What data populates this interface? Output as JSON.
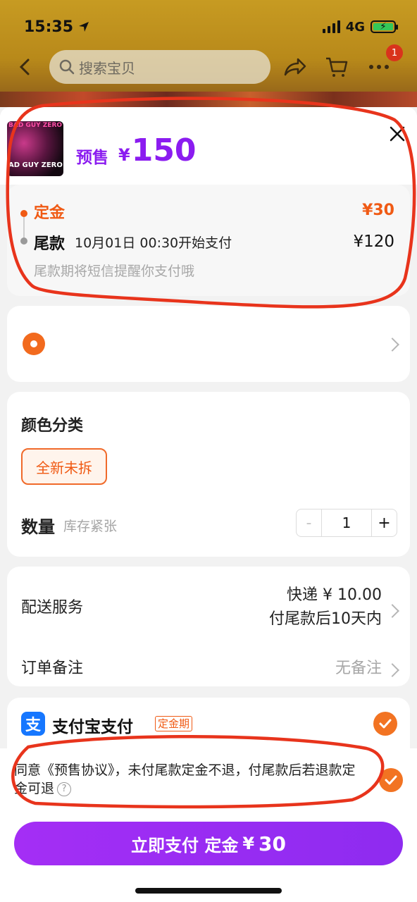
{
  "status_bar": {
    "time": "15:35",
    "network": "4G"
  },
  "nav": {
    "search_placeholder": "搜索宝贝",
    "cart_badge": "1"
  },
  "product": {
    "thumb_text_top": "BAD GUY ZERO",
    "thumb_text_bottom": "AD GUY ZERO",
    "presale_label": "预售",
    "currency": "¥",
    "price": "150"
  },
  "deposit": {
    "deposit_label": "定金",
    "deposit_amount": "¥30",
    "balance_label": "尾款",
    "balance_time": "10月01日 00:30开始支付",
    "balance_amount": "¥120",
    "balance_note": "尾款期将短信提醒你支付哦"
  },
  "options": {
    "color_title": "颜色分类",
    "selected_color": "全新未拆",
    "qty_label": "数量",
    "stock_note": "库存紧张",
    "qty_minus": "-",
    "qty_value": "1",
    "qty_plus": "+"
  },
  "delivery": {
    "label": "配送服务",
    "line1": "快递 ¥ 10.00",
    "line2": "付尾款后10天内",
    "note_label": "订单备注",
    "note_value": "无备注"
  },
  "payment": {
    "alipay_glyph": "支",
    "method": "支付宝支付",
    "tag": "定金期"
  },
  "agreement": {
    "text": "同意《预售协议》，未付尾款定金不退，付尾款后若退款定金可退",
    "help": "?"
  },
  "bottom": {
    "pay_label": "立即支付 定金",
    "pay_currency": "¥",
    "pay_amount": "30"
  },
  "colors": {
    "brand_purple": "#8b1cf0",
    "accent_orange": "#f05a14",
    "annotation_red": "#e8341c"
  }
}
